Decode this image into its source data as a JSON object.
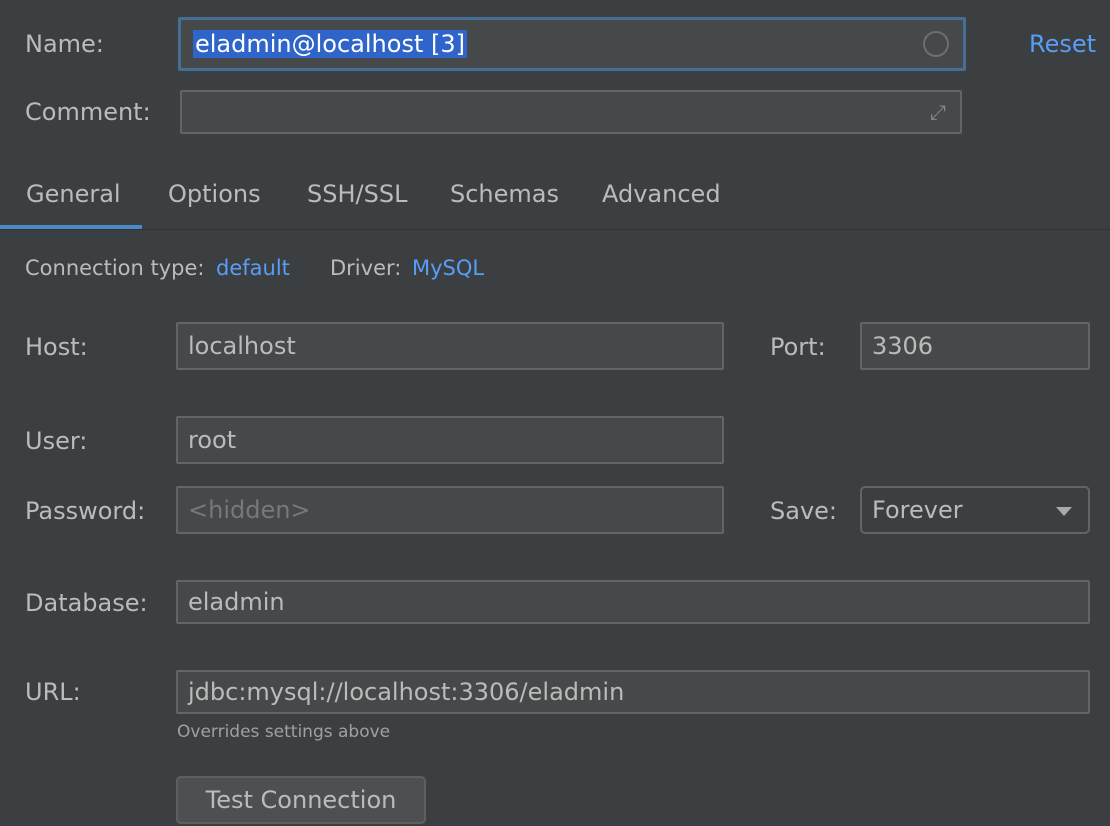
{
  "name": {
    "label": "Name:",
    "value": "eladmin@localhost [3]",
    "reset": "Reset"
  },
  "comment": {
    "label": "Comment:",
    "value": ""
  },
  "tabs": [
    {
      "label": "General",
      "active": true
    },
    {
      "label": "Options"
    },
    {
      "label": "SSH/SSL"
    },
    {
      "label": "Schemas"
    },
    {
      "label": "Advanced"
    }
  ],
  "connection": {
    "type_label": "Connection type:",
    "type_value": "default",
    "driver_label": "Driver:",
    "driver_value": "MySQL"
  },
  "host": {
    "label": "Host:",
    "value": "localhost"
  },
  "port": {
    "label": "Port:",
    "value": "3306"
  },
  "user": {
    "label": "User:",
    "value": "root"
  },
  "password": {
    "label": "Password:",
    "placeholder": "<hidden>"
  },
  "save": {
    "label": "Save:",
    "value": "Forever"
  },
  "database": {
    "label": "Database:",
    "value": "eladmin"
  },
  "url": {
    "label": "URL:",
    "value": "jdbc:mysql://localhost:3306/eladmin",
    "hint": "Overrides settings above"
  },
  "test_button": "Test Connection",
  "colors": {
    "accent": "#589df6",
    "selection": "#2f65ca",
    "background": "#3c3f41"
  }
}
